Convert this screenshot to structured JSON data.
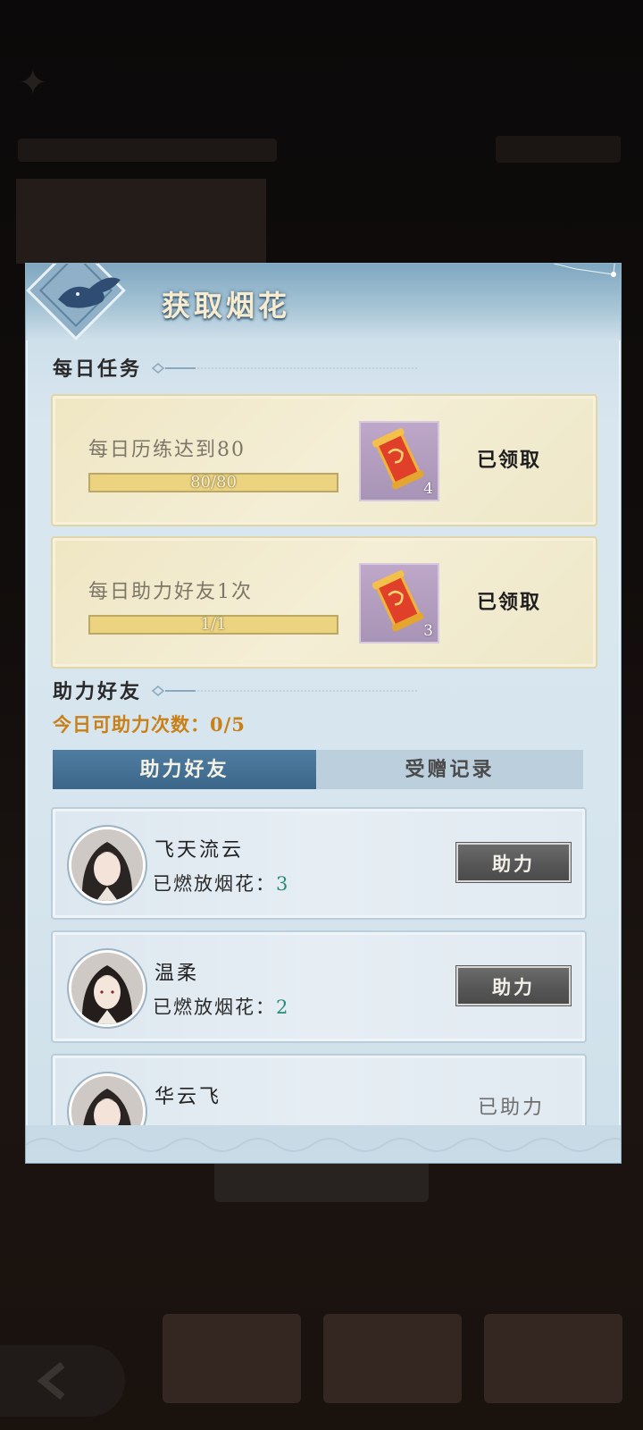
{
  "modal": {
    "title": "获取烟花"
  },
  "daily_tasks": {
    "section_title": "每日任务",
    "items": [
      {
        "name": "每日历练达到80",
        "progress_text": "80/80",
        "progress": 1.0,
        "reward_count": "4",
        "status": "已领取"
      },
      {
        "name": "每日助力好友1次",
        "progress_text": "1/1",
        "progress": 1.0,
        "reward_count": "3",
        "status": "已领取"
      }
    ]
  },
  "assist": {
    "section_title": "助力好友",
    "count_text": "今日可助力次数：0/5",
    "tabs": [
      {
        "label": "助力好友",
        "active": true
      },
      {
        "label": "受赠记录",
        "active": false
      }
    ],
    "fireworks_label": "已燃放烟花：",
    "friends": [
      {
        "name": "飞天流云",
        "fireworks": "3",
        "action": "助力"
      },
      {
        "name": "温柔",
        "fireworks": "2",
        "action": "助力"
      },
      {
        "name": "华云飞",
        "fireworks": "",
        "action": "已助力"
      }
    ]
  },
  "colors": {
    "accent_orange": "#c98017",
    "tab_active": "#3b6689",
    "fireworks_number": "#2a8a7c"
  }
}
